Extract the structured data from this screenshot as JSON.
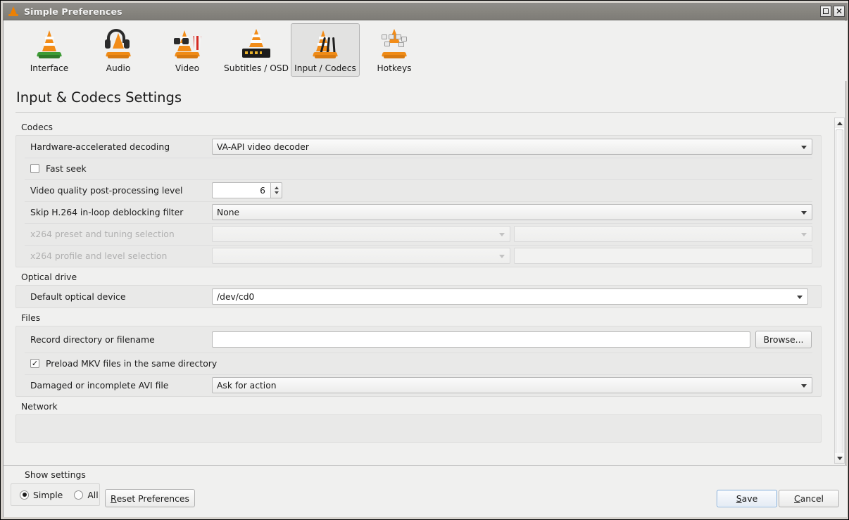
{
  "window": {
    "title": "Simple Preferences",
    "title_icon": "vlc-cone-icon",
    "maximize_label": "",
    "close_label": "✕"
  },
  "toolbar": {
    "tabs": [
      {
        "label": "Interface",
        "icon": "vlc-cone-green-icon",
        "selected": false
      },
      {
        "label": "Audio",
        "icon": "headphones-icon",
        "selected": false
      },
      {
        "label": "Video",
        "icon": "glasses-popcorn-icon",
        "selected": false
      },
      {
        "label": "Subtitles / OSD",
        "icon": "subtitle-bar-icon",
        "selected": false
      },
      {
        "label": "Input / Codecs",
        "icon": "cables-icon",
        "selected": true
      },
      {
        "label": "Hotkeys",
        "icon": "keyboard-icon",
        "selected": false
      }
    ]
  },
  "page": {
    "title": "Input & Codecs Settings"
  },
  "groups": [
    {
      "title": "Codecs",
      "rows": [
        {
          "type": "combo",
          "label": "Hardware-accelerated decoding",
          "value": "VA-API video decoder",
          "disabled": false
        },
        {
          "type": "checkbox",
          "label": "Fast seek",
          "checked": false,
          "check_glyph": ""
        },
        {
          "type": "spin",
          "label": "Video quality post-processing level",
          "value": "6"
        },
        {
          "type": "combo",
          "label": "Skip H.264 in-loop deblocking filter",
          "value": "None",
          "disabled": false
        },
        {
          "type": "dual-combo",
          "label": "x264 preset and tuning selection",
          "value_left": "",
          "value_right": "",
          "disabled": true
        },
        {
          "type": "combo-text",
          "label": "x264 profile and level selection",
          "value_left": "",
          "value_right": "",
          "disabled": true
        }
      ]
    },
    {
      "title": "Optical drive",
      "rows": [
        {
          "type": "editable-combo",
          "label": "Default optical device",
          "value": "/dev/cd0",
          "disabled": false
        }
      ]
    },
    {
      "title": "Files",
      "rows": [
        {
          "type": "text-browse",
          "label": "Record directory or filename",
          "value": "",
          "placeholder": "",
          "button_label": "Browse..."
        },
        {
          "type": "checkbox",
          "label": "Preload MKV files in the same directory",
          "checked": true,
          "check_glyph": "✓"
        },
        {
          "type": "combo",
          "label": "Damaged or incomplete AVI file",
          "value": "Ask for action",
          "disabled": false
        }
      ]
    },
    {
      "title": "Network",
      "rows": []
    }
  ],
  "footer": {
    "show_settings_label": "Show settings",
    "radios": [
      {
        "label": "Simple",
        "selected": true
      },
      {
        "label": "All",
        "selected": false
      }
    ],
    "reset_label_pre": "",
    "reset_mnemonic": "R",
    "reset_label_post": "eset Preferences",
    "save_label_pre": "S",
    "save_mnemonic": "S",
    "save_label_post": "ave",
    "cancel_mnemonic": "C",
    "cancel_label_post": "ancel"
  },
  "scrollbar": {
    "up_arrow": "scroll-up-arrow-icon",
    "down_arrow": "scroll-down-arrow-icon"
  }
}
